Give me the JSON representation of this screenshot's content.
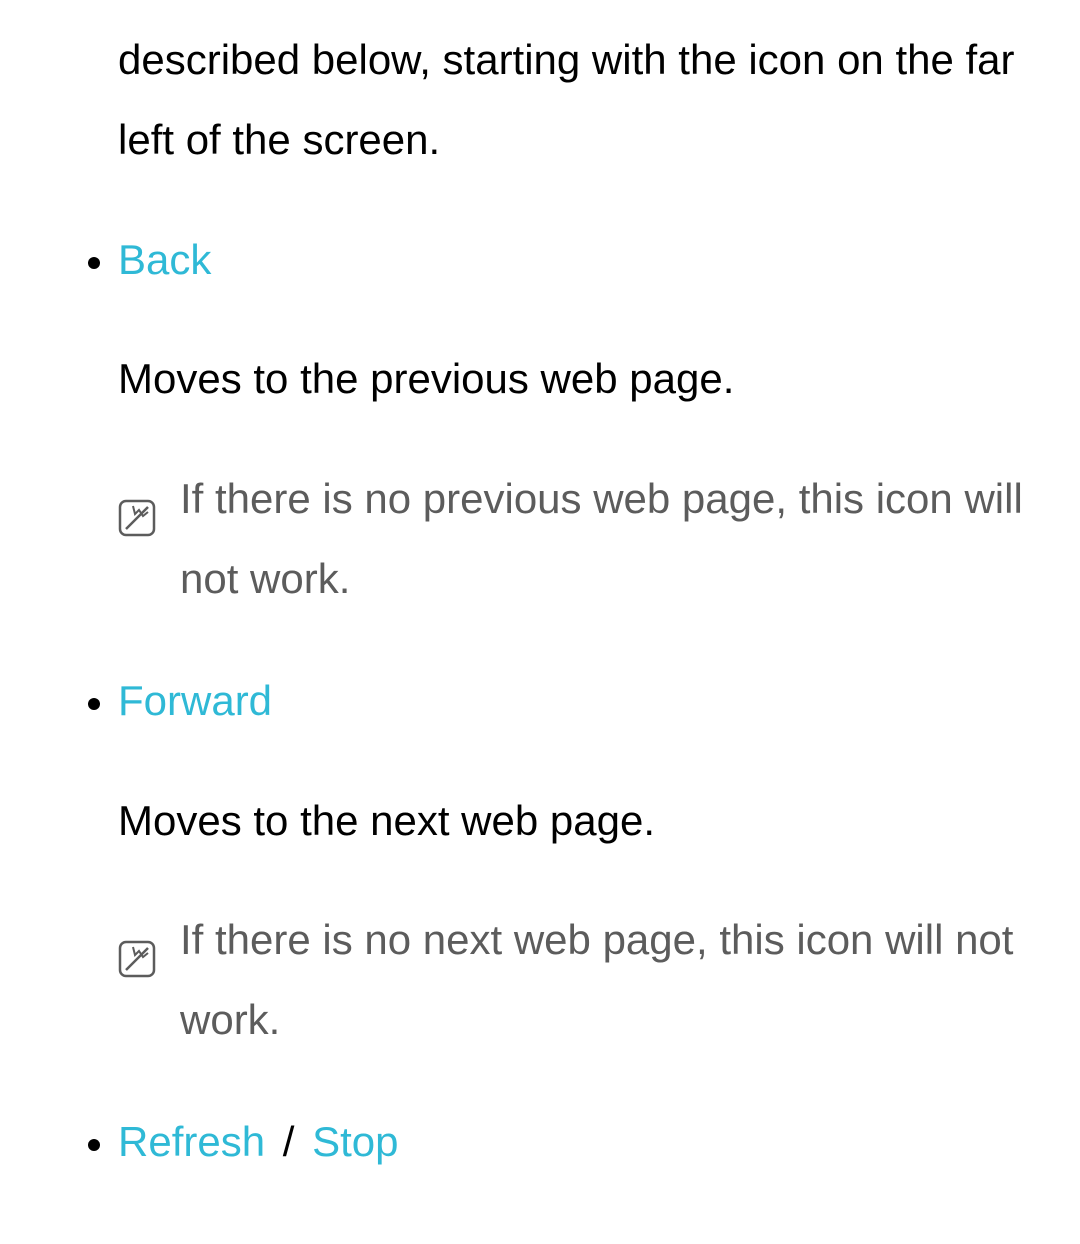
{
  "intro": "described below, starting with the icon on the far left of the screen.",
  "items": [
    {
      "terms": [
        "Back"
      ],
      "desc": "Moves to the previous web page.",
      "note": "If there is no previous web page, this icon will not work."
    },
    {
      "terms": [
        "Forward"
      ],
      "desc": "Moves to the next web page.",
      "note": "If there is no next web page, this icon will not work."
    },
    {
      "terms": [
        "Refresh",
        "Stop"
      ],
      "desc": "",
      "note": ""
    }
  ],
  "separator": " / "
}
